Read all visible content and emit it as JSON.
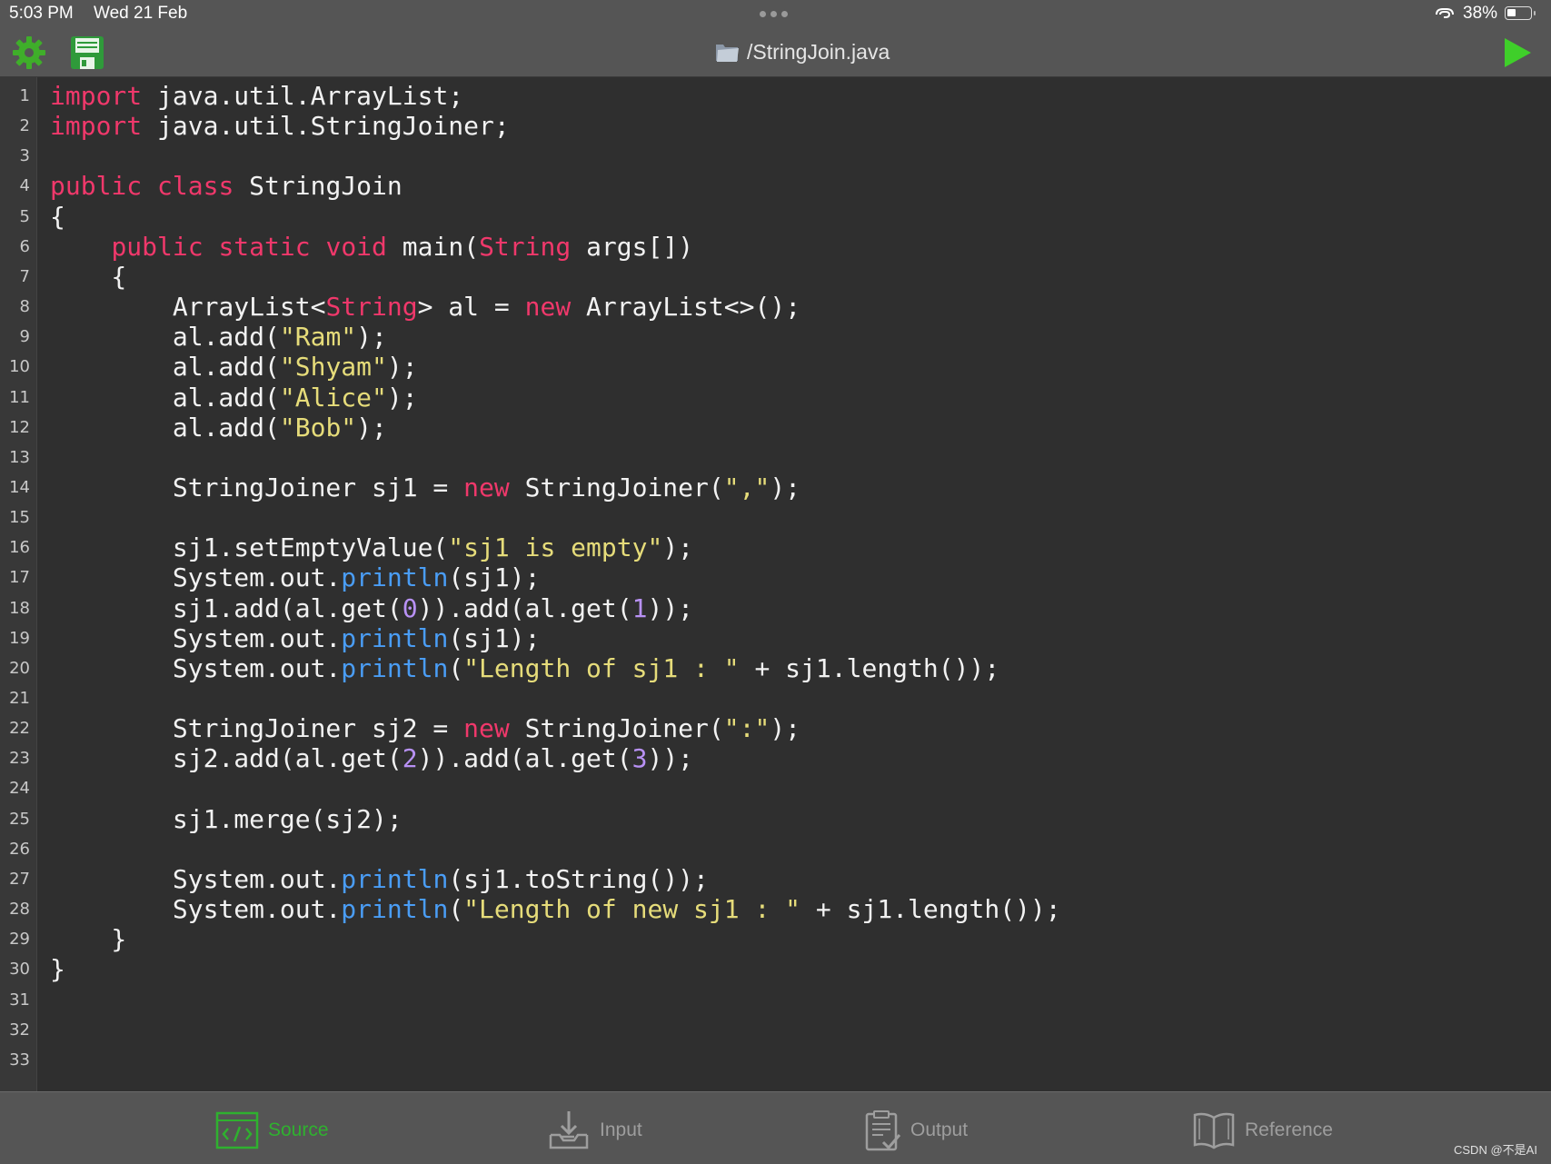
{
  "status_bar": {
    "time": "5:03 PM",
    "date": "Wed 21 Feb",
    "battery": "38%"
  },
  "toolbar": {
    "file_title": "/StringJoin.java",
    "settings_icon": "gear-icon",
    "save_icon": "floppy-disk-icon",
    "run_icon": "play-icon"
  },
  "editor": {
    "language": "java",
    "line_count": 33,
    "lines": [
      {
        "n": "1",
        "t": [
          [
            "kw",
            "import"
          ],
          [
            "p",
            " java.util.ArrayList;"
          ]
        ]
      },
      {
        "n": "2",
        "t": [
          [
            "kw",
            "import"
          ],
          [
            "p",
            " java.util.StringJoiner;"
          ]
        ]
      },
      {
        "n": "3",
        "t": []
      },
      {
        "n": "4",
        "t": [
          [
            "kw",
            "public"
          ],
          [
            "p",
            " "
          ],
          [
            "kw",
            "class"
          ],
          [
            "p",
            " StringJoin"
          ]
        ]
      },
      {
        "n": "5",
        "t": [
          [
            "p",
            "{"
          ]
        ]
      },
      {
        "n": "6",
        "t": [
          [
            "p",
            "    "
          ],
          [
            "kw",
            "public"
          ],
          [
            "p",
            " "
          ],
          [
            "kw",
            "static"
          ],
          [
            "p",
            " "
          ],
          [
            "kw",
            "void"
          ],
          [
            "p",
            " main("
          ],
          [
            "kw",
            "String"
          ],
          [
            "p",
            " args[])"
          ]
        ]
      },
      {
        "n": "7",
        "t": [
          [
            "p",
            "    {"
          ]
        ]
      },
      {
        "n": "8",
        "t": [
          [
            "p",
            "        ArrayList<"
          ],
          [
            "kw",
            "String"
          ],
          [
            "p",
            "> al = "
          ],
          [
            "kw",
            "new"
          ],
          [
            "p",
            " ArrayList<>();"
          ]
        ]
      },
      {
        "n": "9",
        "t": [
          [
            "p",
            "        al.add("
          ],
          [
            "str",
            "\"Ram\""
          ],
          [
            "p",
            ");"
          ]
        ]
      },
      {
        "n": "10",
        "t": [
          [
            "p",
            "        al.add("
          ],
          [
            "str",
            "\"Shyam\""
          ],
          [
            "p",
            ");"
          ]
        ]
      },
      {
        "n": "11",
        "t": [
          [
            "p",
            "        al.add("
          ],
          [
            "str",
            "\"Alice\""
          ],
          [
            "p",
            ");"
          ]
        ]
      },
      {
        "n": "12",
        "t": [
          [
            "p",
            "        al.add("
          ],
          [
            "str",
            "\"Bob\""
          ],
          [
            "p",
            ");"
          ]
        ]
      },
      {
        "n": "13",
        "t": []
      },
      {
        "n": "14",
        "t": [
          [
            "p",
            "        StringJoiner sj1 = "
          ],
          [
            "kw",
            "new"
          ],
          [
            "p",
            " StringJoiner("
          ],
          [
            "str",
            "\",\""
          ],
          [
            "p",
            ");"
          ]
        ]
      },
      {
        "n": "15",
        "t": []
      },
      {
        "n": "16",
        "t": [
          [
            "p",
            "        sj1.setEmptyValue("
          ],
          [
            "str",
            "\"sj1 is empty\""
          ],
          [
            "p",
            ");"
          ]
        ]
      },
      {
        "n": "17",
        "t": [
          [
            "p",
            "        System.out."
          ],
          [
            "fn",
            "println"
          ],
          [
            "p",
            "(sj1);"
          ]
        ]
      },
      {
        "n": "18",
        "t": [
          [
            "p",
            "        sj1.add(al.get("
          ],
          [
            "num",
            "0"
          ],
          [
            "p",
            ")).add(al.get("
          ],
          [
            "num",
            "1"
          ],
          [
            "p",
            "));"
          ]
        ]
      },
      {
        "n": "19",
        "t": [
          [
            "p",
            "        System.out."
          ],
          [
            "fn",
            "println"
          ],
          [
            "p",
            "(sj1);"
          ]
        ]
      },
      {
        "n": "20",
        "t": [
          [
            "p",
            "        System.out."
          ],
          [
            "fn",
            "println"
          ],
          [
            "p",
            "("
          ],
          [
            "str",
            "\"Length of sj1 : \""
          ],
          [
            "p",
            " + sj1.length());"
          ]
        ]
      },
      {
        "n": "21",
        "t": []
      },
      {
        "n": "22",
        "t": [
          [
            "p",
            "        StringJoiner sj2 = "
          ],
          [
            "kw",
            "new"
          ],
          [
            "p",
            " StringJoiner("
          ],
          [
            "str",
            "\":\""
          ],
          [
            "p",
            ");"
          ]
        ]
      },
      {
        "n": "23",
        "t": [
          [
            "p",
            "        sj2.add(al.get("
          ],
          [
            "num",
            "2"
          ],
          [
            "p",
            ")).add(al.get("
          ],
          [
            "num",
            "3"
          ],
          [
            "p",
            "));"
          ]
        ]
      },
      {
        "n": "24",
        "t": []
      },
      {
        "n": "25",
        "t": [
          [
            "p",
            "        sj1.merge(sj2);"
          ]
        ]
      },
      {
        "n": "26",
        "t": []
      },
      {
        "n": "27",
        "t": [
          [
            "p",
            "        System.out."
          ],
          [
            "fn",
            "println"
          ],
          [
            "p",
            "(sj1.toString());"
          ]
        ]
      },
      {
        "n": "28",
        "t": [
          [
            "p",
            "        System.out."
          ],
          [
            "fn",
            "println"
          ],
          [
            "p",
            "("
          ],
          [
            "str",
            "\"Length of new sj1 : \""
          ],
          [
            "p",
            " + sj1.length());"
          ]
        ]
      },
      {
        "n": "29",
        "t": [
          [
            "p",
            "    }"
          ]
        ]
      },
      {
        "n": "30",
        "t": [
          [
            "p",
            "}"
          ]
        ]
      },
      {
        "n": "31",
        "t": []
      },
      {
        "n": "32",
        "t": []
      },
      {
        "n": "33",
        "t": []
      }
    ]
  },
  "tabbar": {
    "tabs": [
      {
        "label": "Source",
        "icon": "code-icon",
        "active": true
      },
      {
        "label": "Input",
        "icon": "download-tray-icon",
        "active": false
      },
      {
        "label": "Output",
        "icon": "clipboard-check-icon",
        "active": false
      },
      {
        "label": "Reference",
        "icon": "book-icon",
        "active": false
      }
    ]
  },
  "watermark": "CSDN @不是AI",
  "colors": {
    "keyword": "#f0386b",
    "string": "#e6dc7a",
    "number": "#b891f5",
    "method": "#4a9df5",
    "plain": "#f2f2f2",
    "accent_green": "#2fb12f",
    "bar_bg": "#555555",
    "editor_bg": "#2f2f2f"
  }
}
